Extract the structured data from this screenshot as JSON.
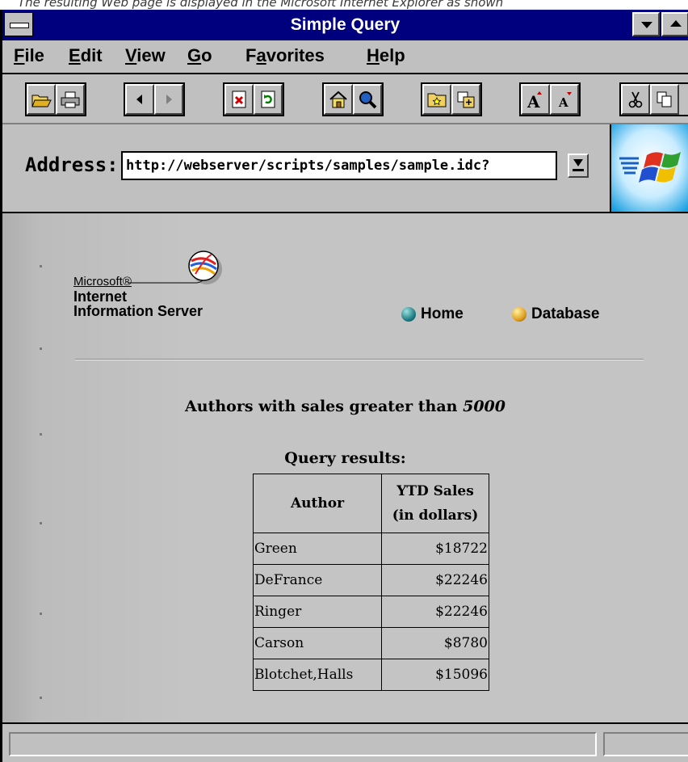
{
  "caption": "The resulting Web page is displayed in the Microsoft Internet Explorer as shown",
  "window": {
    "title": "Simple Query"
  },
  "menu": [
    {
      "label": "File"
    },
    {
      "label": "Edit"
    },
    {
      "label": "View"
    },
    {
      "label": "Go"
    },
    {
      "label": "Favorites"
    },
    {
      "label": "Help"
    }
  ],
  "toolbar": {
    "groups": [
      [
        "open-icon",
        "print-icon"
      ],
      [
        "back-icon",
        "forward-icon"
      ],
      [
        "stop-icon",
        "refresh-icon"
      ],
      [
        "home-icon",
        "search-icon"
      ],
      [
        "favorites-icon",
        "add-favorite-icon"
      ],
      [
        "larger-font-icon",
        "smaller-font-icon"
      ],
      [
        "cut-icon",
        "copy-icon"
      ]
    ]
  },
  "address": {
    "label": "Address:",
    "value": "http://webserver/scripts/samples/sample.idc?"
  },
  "page": {
    "brand_ms": "Microsoft®",
    "brand_line1": "Internet",
    "brand_line2": "Information Server",
    "nav_home": "Home",
    "nav_database": "Database",
    "heading_prefix": "Authors with sales greater than",
    "heading_value": "5000",
    "results_title": "Query results:",
    "table": {
      "col_author": "Author",
      "col_sales_line1": "YTD Sales",
      "col_sales_line2": "(in dollars)",
      "rows": [
        {
          "author": "Green",
          "sales": "$18722"
        },
        {
          "author": "DeFrance",
          "sales": "$22246"
        },
        {
          "author": "Ringer",
          "sales": "$22246"
        },
        {
          "author": "Carson",
          "sales": "$8780"
        },
        {
          "author": "Blotchet,Halls",
          "sales": "$15096"
        }
      ]
    }
  },
  "colors": {
    "titlebar": "#00007f",
    "window_face": "#c0c0c0",
    "home_ball": "#1f7f86",
    "database_ball": "#e0a020"
  }
}
